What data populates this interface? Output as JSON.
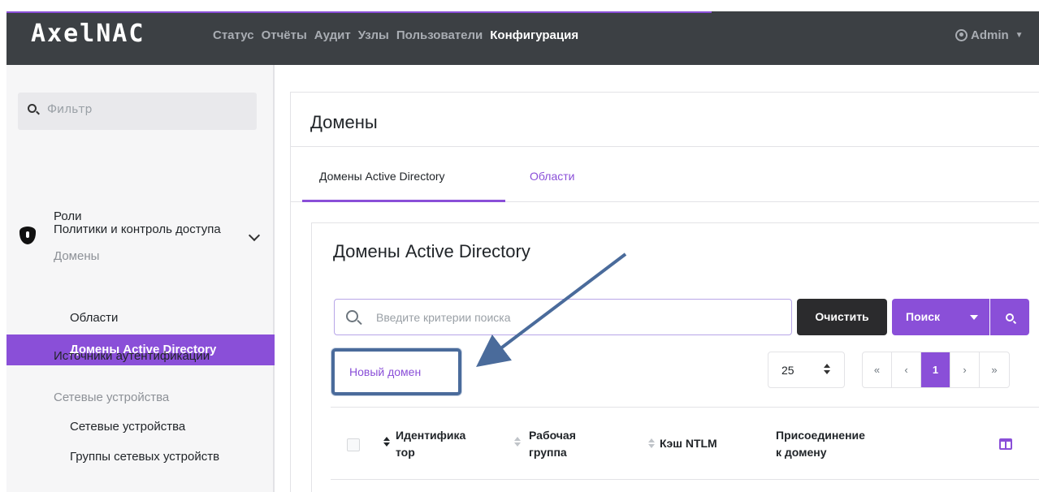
{
  "header": {
    "brand": "AxelNAC",
    "nav": [
      "Статус",
      "Отчёты",
      "Аудит",
      "Узлы",
      "Пользователи",
      "Конфигурация"
    ],
    "active_nav": "Конфигурация",
    "user": "Admin"
  },
  "sidebar": {
    "filter_placeholder": "Фильтр",
    "section_title": "Политики и контроль доступа",
    "items": {
      "roles": "Роли",
      "domains": "Домены",
      "ad_domains": "Домены Active Directory",
      "realms": "Области",
      "auth_sources": "Источники аутентификации",
      "network_devices_group": "Сетевые устройства",
      "network_devices": "Сетевые устройства",
      "network_device_groups": "Группы сетевых устройств"
    }
  },
  "main": {
    "title": "Домены",
    "tabs": [
      "Домены Active Directory",
      "Области"
    ],
    "section_title": "Домены Active Directory",
    "search_placeholder": "Введите критерии поиска",
    "clear_label": "Очистить",
    "search_label": "Поиск",
    "new_domain_label": "Новый домен",
    "per_page": "25",
    "pager": {
      "first": "«",
      "prev": "‹",
      "current": "1",
      "next": "›",
      "last": "»"
    },
    "columns": [
      "Идентификатор",
      "Рабочая группа",
      "Кэш NTLM",
      "Присоединение к домену"
    ]
  },
  "colors": {
    "accent": "#8a4fd8",
    "topbar": "#3c4044",
    "annotation": "#4a6b9b"
  },
  "icons": [
    "search-icon",
    "shield-icon",
    "chevron-down-icon",
    "user-icon",
    "caret-down-icon",
    "zoom-icon",
    "sort-icon",
    "columns-icon",
    "arrow-annotation"
  ]
}
